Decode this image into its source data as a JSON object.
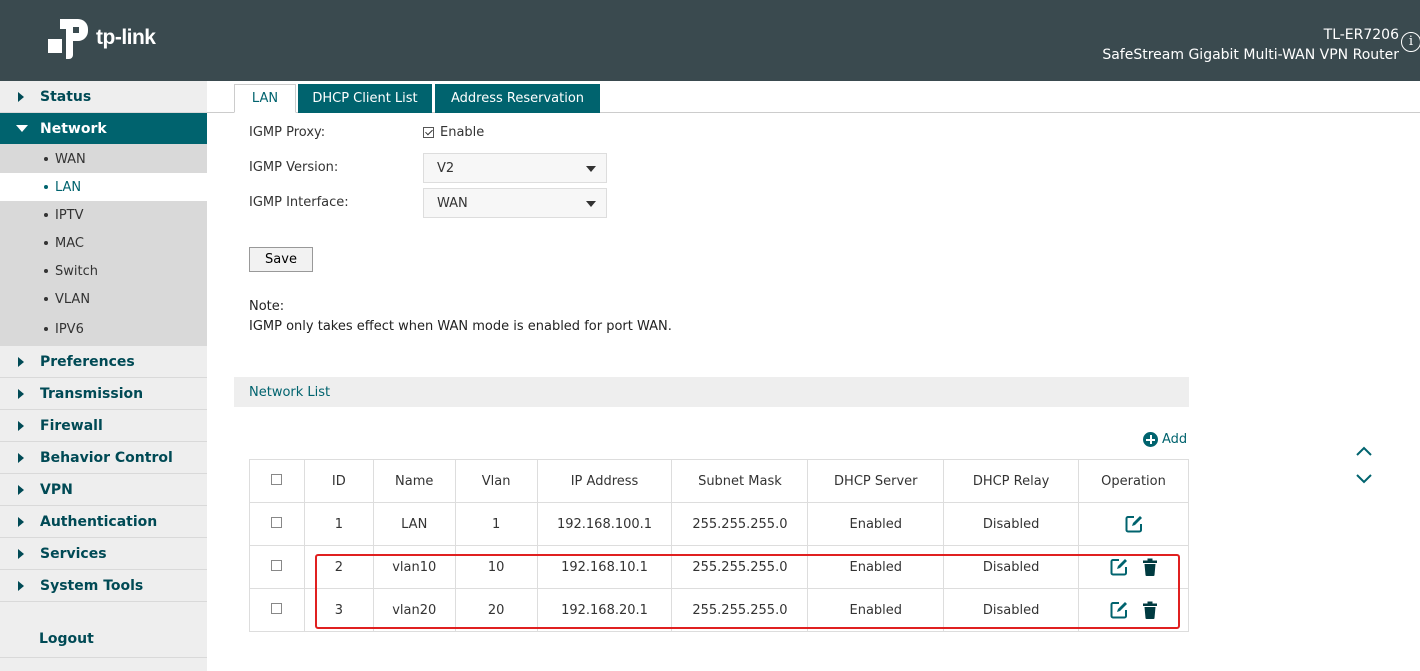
{
  "header": {
    "logo_text": "tp-link",
    "model": "TL-ER7206",
    "subtitle": "SafeStream Gigabit Multi-WAN VPN Router",
    "info_glyph": "i"
  },
  "sidebar": {
    "items": [
      {
        "label": "Status",
        "active": false
      },
      {
        "label": "Network",
        "active": true,
        "children": [
          {
            "label": "WAN",
            "active": false
          },
          {
            "label": "LAN",
            "active": true
          },
          {
            "label": "IPTV",
            "active": false
          },
          {
            "label": "MAC",
            "active": false
          },
          {
            "label": "Switch",
            "active": false
          },
          {
            "label": "VLAN",
            "active": false
          },
          {
            "label": "IPV6",
            "active": false
          }
        ]
      },
      {
        "label": "Preferences",
        "active": false
      },
      {
        "label": "Transmission",
        "active": false
      },
      {
        "label": "Firewall",
        "active": false
      },
      {
        "label": "Behavior Control",
        "active": false
      },
      {
        "label": "VPN",
        "active": false
      },
      {
        "label": "Authentication",
        "active": false
      },
      {
        "label": "Services",
        "active": false
      },
      {
        "label": "System Tools",
        "active": false
      }
    ],
    "logout": "Logout"
  },
  "tabs": [
    {
      "label": "LAN",
      "active": true
    },
    {
      "label": "DHCP Client List",
      "active": false
    },
    {
      "label": "Address Reservation",
      "active": false
    }
  ],
  "form": {
    "igmp_proxy_label": "IGMP Proxy:",
    "igmp_proxy_checked": true,
    "igmp_proxy_option": "Enable",
    "igmp_version_label": "IGMP Version:",
    "igmp_version_value": "V2",
    "igmp_interface_label": "IGMP Interface:",
    "igmp_interface_value": "WAN",
    "save_label": "Save",
    "note_title": "Note:",
    "note_text": "IGMP only takes effect when WAN mode is enabled for port WAN."
  },
  "network_list": {
    "title": "Network List",
    "add_label": "Add",
    "columns": [
      "ID",
      "Name",
      "Vlan",
      "IP Address",
      "Subnet Mask",
      "DHCP Server",
      "DHCP Relay",
      "Operation"
    ],
    "rows": [
      {
        "id": "1",
        "name": "LAN",
        "vlan": "1",
        "ip": "192.168.100.1",
        "mask": "255.255.255.0",
        "dhcp_server": "Enabled",
        "dhcp_relay": "Disabled",
        "deletable": false
      },
      {
        "id": "2",
        "name": "vlan10",
        "vlan": "10",
        "ip": "192.168.10.1",
        "mask": "255.255.255.0",
        "dhcp_server": "Enabled",
        "dhcp_relay": "Disabled",
        "deletable": true
      },
      {
        "id": "3",
        "name": "vlan20",
        "vlan": "20",
        "ip": "192.168.20.1",
        "mask": "255.255.255.0",
        "dhcp_server": "Enabled",
        "dhcp_relay": "Disabled",
        "deletable": true
      }
    ]
  },
  "colors": {
    "header_bg": "#3a4a4f",
    "accent": "#00636e",
    "highlight": "#e02020"
  },
  "icons": [
    "tp-link-logo-icon",
    "info-icon",
    "add-icon",
    "edit-icon",
    "trash-icon",
    "chevron-up-icon",
    "chevron-down-icon"
  ]
}
